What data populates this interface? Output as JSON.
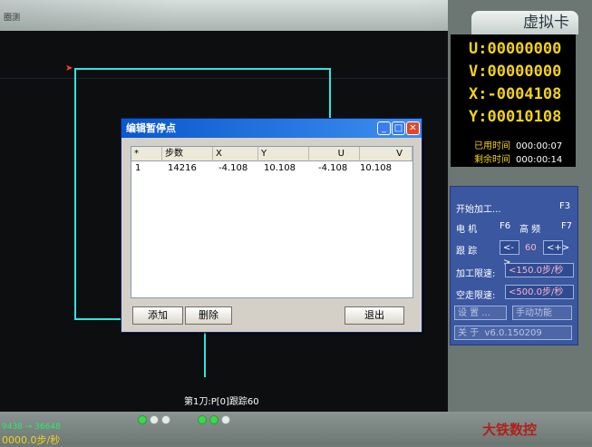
{
  "top_fragment": "圈测",
  "canvas": {
    "status_line": "第1刀:P[0]跟踪60"
  },
  "right_panel": {
    "title": "虚拟卡",
    "coords": {
      "U": "U:00000000",
      "V": "V:00000000",
      "X": "X:-0004108",
      "Y": "Y:00010108"
    },
    "times": {
      "used_label": "已用时间",
      "used": "000:00:07",
      "remain_label": "剩余时间",
      "remain": "000:00:14"
    },
    "menu": {
      "start": "开始加工...",
      "start_key": "F3",
      "motor": "电 机",
      "motor_key": "F6",
      "hf": "高 频",
      "hf_key": "F7",
      "track": "跟 踪",
      "track_dec": "<->",
      "track_val": "60",
      "track_inc": "<+>",
      "work_speed_label": "加工限速:",
      "work_speed": "<150.0步/秒",
      "idle_speed_label": "空走限速:",
      "idle_speed": "<500.0步/秒",
      "settings": "设 置 ...",
      "manual": "手动功能",
      "about_label": "关 于",
      "about_ver": "v6.0.150209"
    }
  },
  "dialog": {
    "title": "编辑暂停点",
    "headers": [
      "*",
      "步数",
      "X",
      "Y",
      "U",
      "V"
    ],
    "rows": [
      {
        "idx": "1",
        "steps": "14216",
        "x": "-4.108",
        "y": "10.108",
        "u": "-4.108",
        "v": "10.108"
      }
    ],
    "add": "添加",
    "delete": "删除",
    "exit": "退出"
  },
  "bottom": {
    "left_top": "9438 → 36648",
    "left_speed": "0000.0步/秒",
    "brand": "大铁数控"
  },
  "colors": {
    "accent_yellow": "#f2d21b",
    "menu_blue": "#3a57a0",
    "cyan_path": "#2ee6e0"
  }
}
